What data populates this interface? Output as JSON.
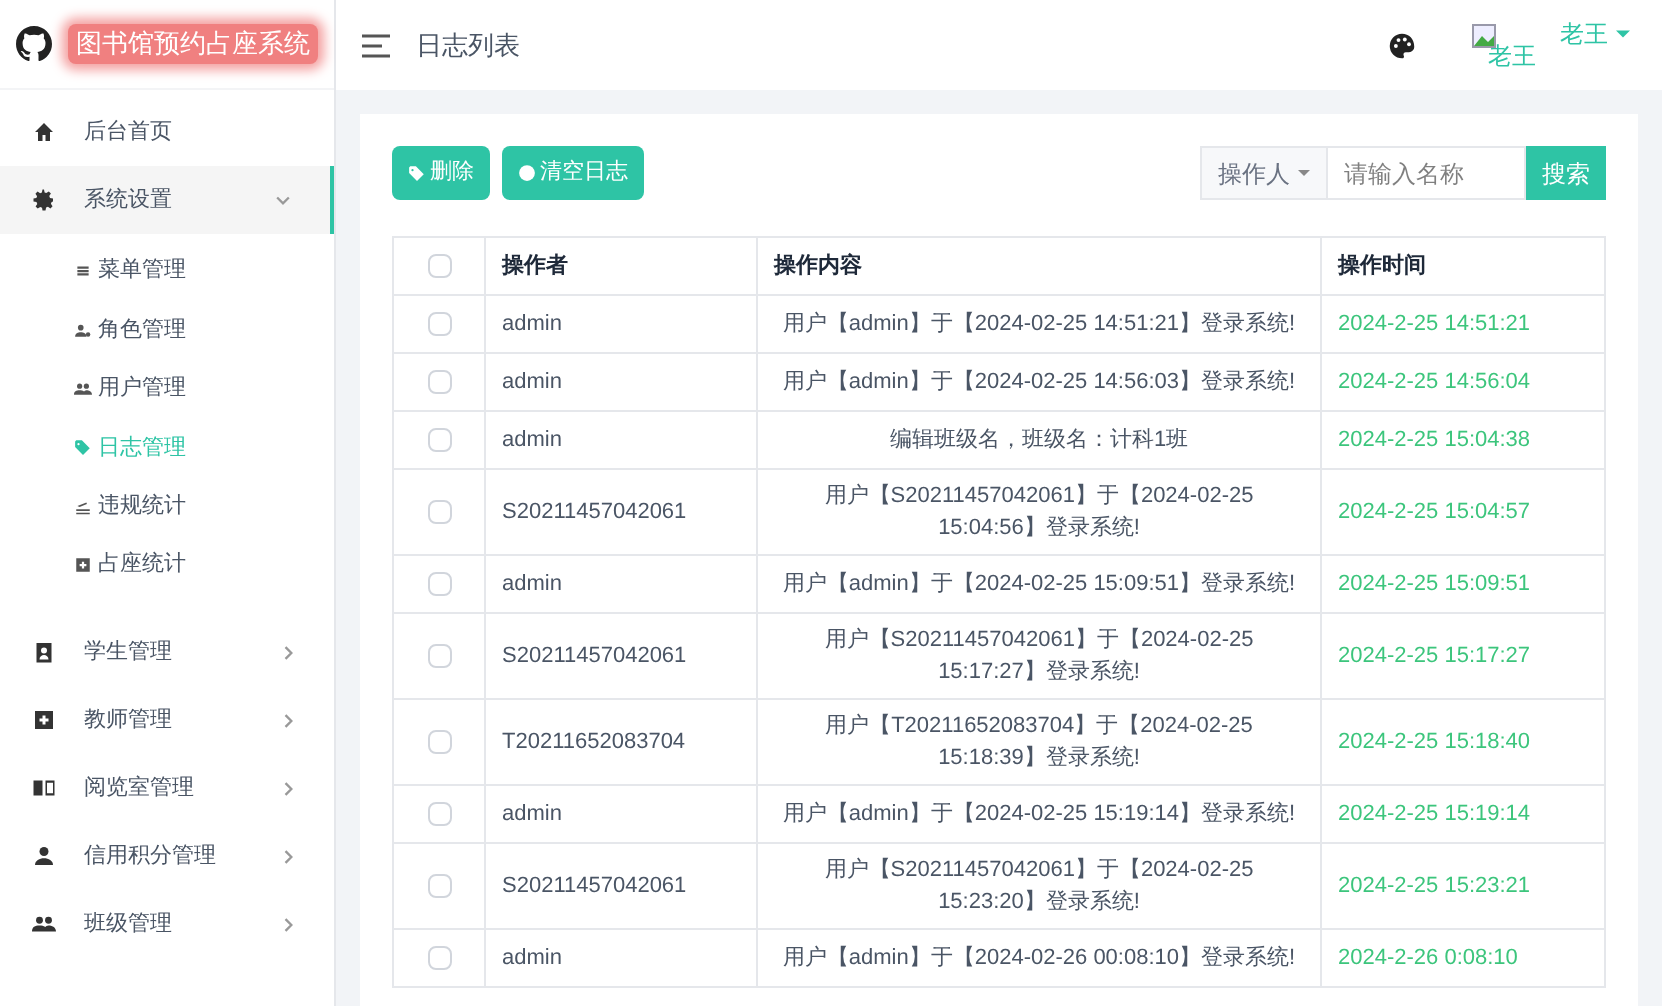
{
  "brand": {
    "title": "图书馆预约占座系统"
  },
  "header": {
    "page_title": "日志列表",
    "avatar_alt": "老王",
    "user_name": "老王"
  },
  "sidebar": {
    "items": [
      {
        "label": "后台首页",
        "selected": false
      },
      {
        "label": "系统设置",
        "expanded": true,
        "selected": true,
        "children": [
          {
            "label": "菜单管理",
            "selected": false
          },
          {
            "label": "角色管理",
            "selected": false
          },
          {
            "label": "用户管理",
            "selected": false
          },
          {
            "label": "日志管理",
            "selected": true
          },
          {
            "label": "违规统计",
            "selected": false
          },
          {
            "label": "占座统计",
            "selected": false
          }
        ]
      },
      {
        "label": "学生管理",
        "expanded": false,
        "selected": false
      },
      {
        "label": "教师管理",
        "expanded": false,
        "selected": false
      },
      {
        "label": "阅览室管理",
        "expanded": false,
        "selected": false
      },
      {
        "label": "信用积分管理",
        "expanded": false,
        "selected": false
      },
      {
        "label": "班级管理",
        "expanded": false,
        "selected": false
      }
    ]
  },
  "toolbar": {
    "buttons": [
      {
        "label": "删除"
      },
      {
        "label": "清空日志"
      }
    ],
    "filter": {
      "label": "操作人",
      "placeholder": "请输入名称"
    },
    "search_button": "搜索"
  },
  "table": {
    "all_checked": false,
    "columns": [
      "操作者",
      "操作内容",
      "操作时间"
    ],
    "rows": [
      {
        "checked": false,
        "operator": "admin",
        "content": "用户【admin】于【2024-02-25 14:51:21】登录系统!",
        "time": "2024-2-25 14:51:21"
      },
      {
        "checked": false,
        "operator": "admin",
        "content": "用户【admin】于【2024-02-25 14:56:03】登录系统!",
        "time": "2024-2-25 14:56:04"
      },
      {
        "checked": false,
        "operator": "admin",
        "content": "编辑班级名，班级名：计科1班",
        "time": "2024-2-25 15:04:38"
      },
      {
        "checked": false,
        "operator": "S20211457042061",
        "content": "用户【S20211457042061】于【2024-02-25 15:04:56】登录系统!",
        "time": "2024-2-25 15:04:57"
      },
      {
        "checked": false,
        "operator": "admin",
        "content": "用户【admin】于【2024-02-25 15:09:51】登录系统!",
        "time": "2024-2-25 15:09:51"
      },
      {
        "checked": false,
        "operator": "S20211457042061",
        "content": "用户【S20211457042061】于【2024-02-25 15:17:27】登录系统!",
        "time": "2024-2-25 15:17:27"
      },
      {
        "checked": false,
        "operator": "T20211652083704",
        "content": "用户【T20211652083704】于【2024-02-25 15:18:39】登录系统!",
        "time": "2024-2-25 15:18:40"
      },
      {
        "checked": false,
        "operator": "admin",
        "content": "用户【admin】于【2024-02-25 15:19:14】登录系统!",
        "time": "2024-2-25 15:19:14"
      },
      {
        "checked": false,
        "operator": "S20211457042061",
        "content": "用户【S20211457042061】于【2024-02-25 15:23:20】登录系统!",
        "time": "2024-2-25 15:23:21"
      },
      {
        "checked": false,
        "operator": "admin",
        "content": "用户【admin】于【2024-02-26 00:08:10】登录系统!",
        "time": "2024-2-26 0:08:10"
      }
    ]
  }
}
